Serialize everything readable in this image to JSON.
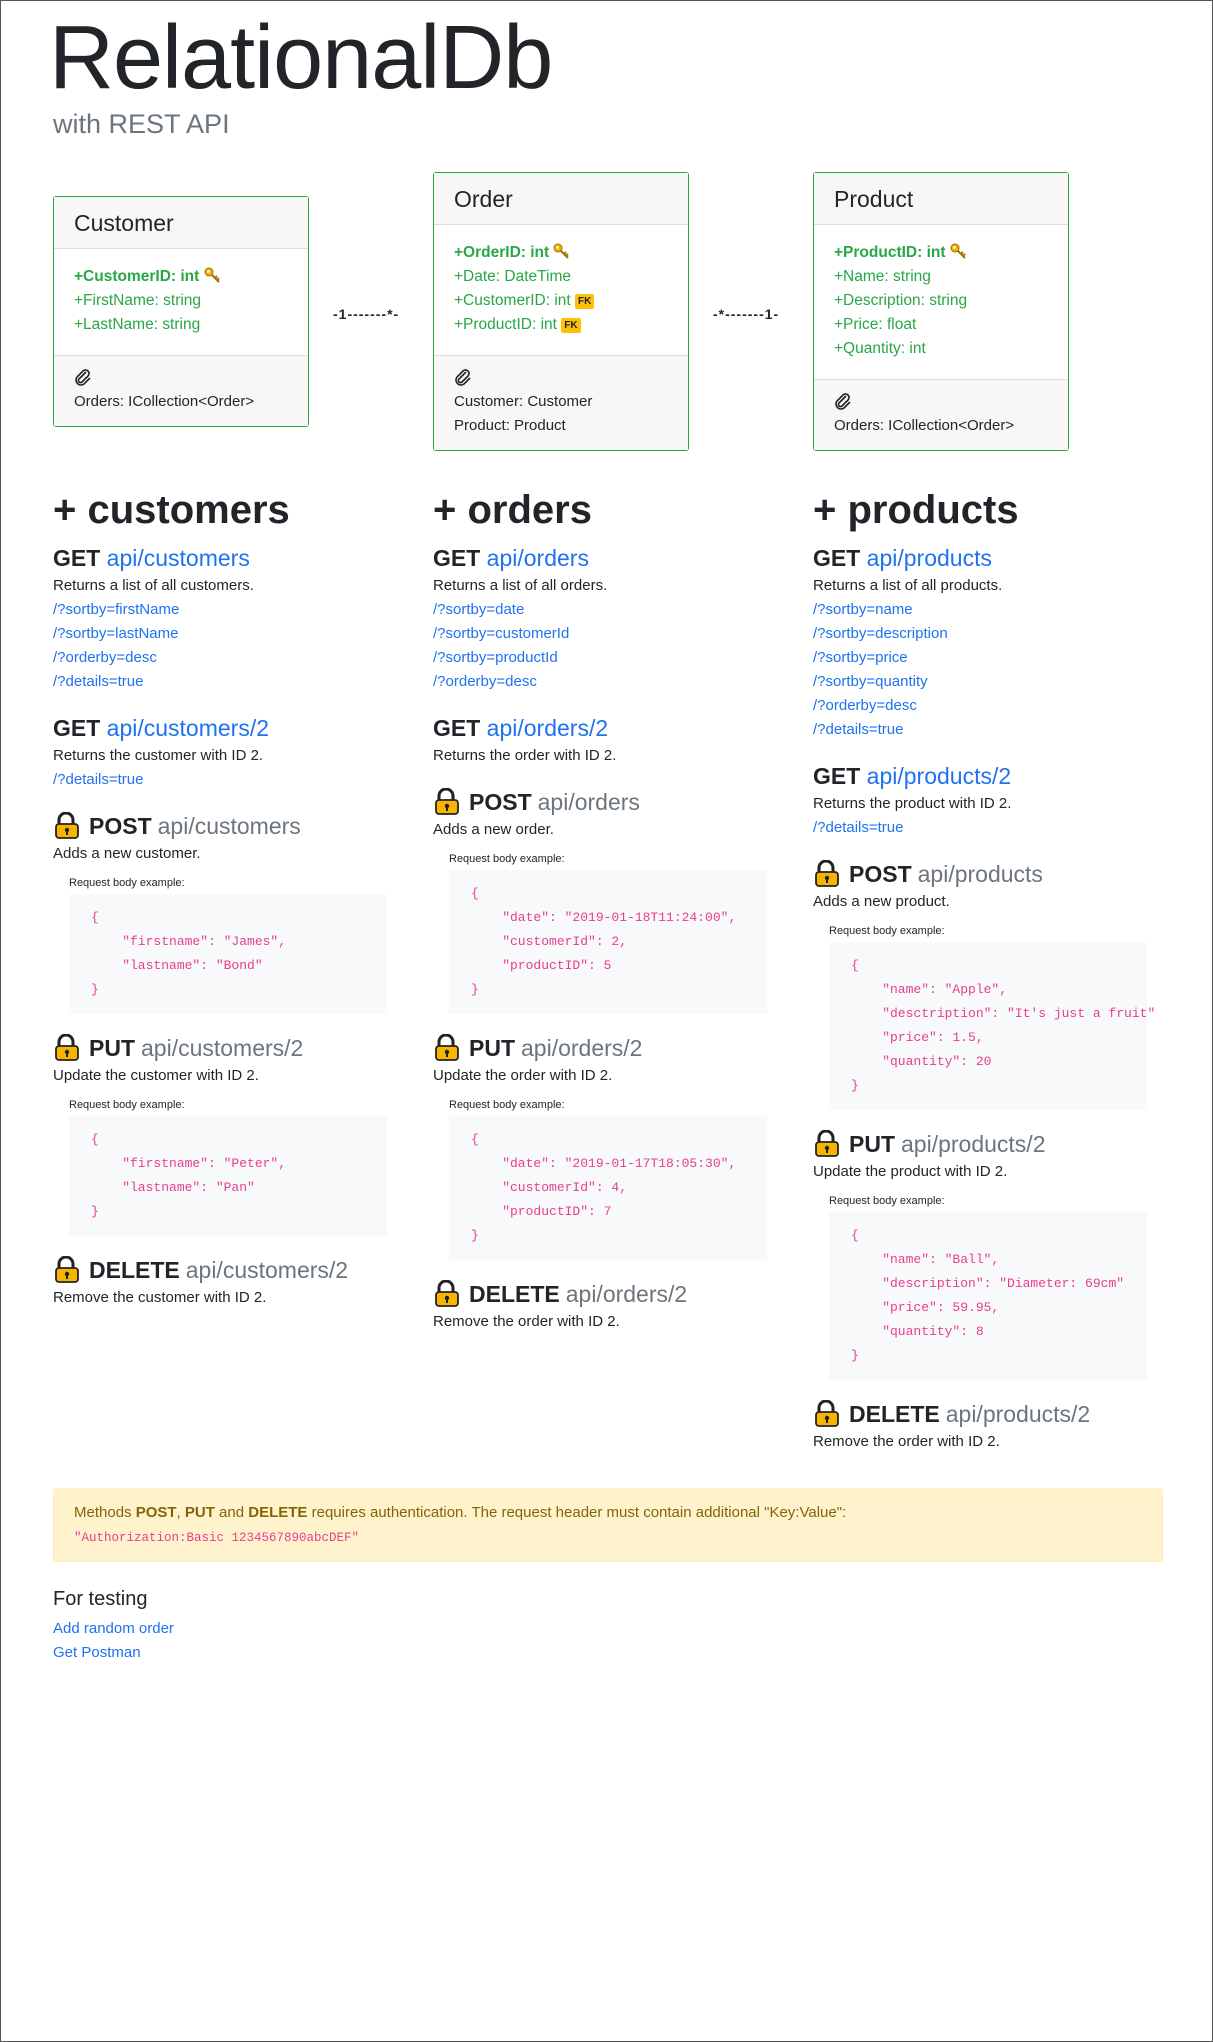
{
  "header": {
    "title": "RelationalDb",
    "subtitle": "with REST API"
  },
  "entities": [
    {
      "name": "Customer",
      "props": [
        {
          "text": "+CustomerID: int",
          "pk": true,
          "fk": false
        },
        {
          "text": "+FirstName: string",
          "pk": false,
          "fk": false
        },
        {
          "text": "+LastName: string",
          "pk": false,
          "fk": false
        }
      ],
      "nav": [
        "Orders: ICollection<Order>"
      ]
    },
    {
      "name": "Order",
      "props": [
        {
          "text": "+OrderID: int",
          "pk": true,
          "fk": false
        },
        {
          "text": "+Date: DateTime",
          "pk": false,
          "fk": false
        },
        {
          "text": "+CustomerID: int",
          "pk": false,
          "fk": true
        },
        {
          "text": "+ProductID: int",
          "pk": false,
          "fk": true
        }
      ],
      "nav": [
        "Customer: Customer",
        "Product: Product"
      ]
    },
    {
      "name": "Product",
      "props": [
        {
          "text": "+ProductID: int",
          "pk": true,
          "fk": false
        },
        {
          "text": "+Name: string",
          "pk": false,
          "fk": false
        },
        {
          "text": "+Description: string",
          "pk": false,
          "fk": false
        },
        {
          "text": "+Price: float",
          "pk": false,
          "fk": false
        },
        {
          "text": "+Quantity: int",
          "pk": false,
          "fk": false
        }
      ],
      "nav": [
        "Orders: ICollection<Order>"
      ]
    }
  ],
  "fk_label": "FK",
  "relations": [
    "-1-------*-",
    "-*-------1-"
  ],
  "columns": [
    {
      "section": "+ customers",
      "get_all": {
        "verb": "GET",
        "url": "api/customers",
        "desc": "Returns a list of all customers.",
        "links": [
          "/?sortby=firstName",
          "/?sortby=lastName",
          "/?orderby=desc",
          "/?details=true"
        ]
      },
      "get_one": {
        "verb": "GET",
        "url": "api/customers/2",
        "desc": "Returns the customer with ID 2.",
        "links": [
          "/?details=true"
        ]
      },
      "post": {
        "verb": "POST",
        "path": "api/customers",
        "desc": "Adds a new customer.",
        "body_label": "Request body example:",
        "body": "{\n    \"firstname\": \"James\",\n    \"lastname\": \"Bond\"\n}"
      },
      "put": {
        "verb": "PUT",
        "path": "api/customers/2",
        "desc": "Update the customer with ID 2.",
        "body_label": "Request body example:",
        "body": "{\n    \"firstname\": \"Peter\",\n    \"lastname\": \"Pan\"\n}"
      },
      "delete": {
        "verb": "DELETE",
        "path": "api/customers/2",
        "desc": "Remove the customer with ID 2."
      }
    },
    {
      "section": "+ orders",
      "get_all": {
        "verb": "GET",
        "url": "api/orders",
        "desc": "Returns a list of all orders.",
        "links": [
          "/?sortby=date",
          "/?sortby=customerId",
          "/?sortby=productId",
          "/?orderby=desc"
        ]
      },
      "get_one": {
        "verb": "GET",
        "url": "api/orders/2",
        "desc": "Returns the order with ID 2.",
        "links": []
      },
      "post": {
        "verb": "POST",
        "path": "api/orders",
        "desc": "Adds a new order.",
        "body_label": "Request body example:",
        "body": "{\n    \"date\": \"2019-01-18T11:24:00\",\n    \"customerId\": 2,\n    \"productID\": 5\n}"
      },
      "put": {
        "verb": "PUT",
        "path": "api/orders/2",
        "desc": "Update the order with ID 2.",
        "body_label": "Request body example:",
        "body": "{\n    \"date\": \"2019-01-17T18:05:30\",\n    \"customerId\": 4,\n    \"productID\": 7\n}"
      },
      "delete": {
        "verb": "DELETE",
        "path": "api/orders/2",
        "desc": "Remove the order with ID 2."
      }
    },
    {
      "section": "+ products",
      "get_all": {
        "verb": "GET",
        "url": "api/products",
        "desc": "Returns a list of all products.",
        "links": [
          "/?sortby=name",
          "/?sortby=description",
          "/?sortby=price",
          "/?sortby=quantity",
          "/?orderby=desc",
          "/?details=true"
        ]
      },
      "get_one": {
        "verb": "GET",
        "url": "api/products/2",
        "desc": "Returns the product with ID 2.",
        "links": [
          "/?details=true"
        ]
      },
      "post": {
        "verb": "POST",
        "path": "api/products",
        "desc": "Adds a new product.",
        "body_label": "Request body example:",
        "body": "{\n    \"name\": \"Apple\",\n    \"desctription\": \"It's just a fruit\"\n    \"price\": 1.5,\n    \"quantity\": 20\n}"
      },
      "put": {
        "verb": "PUT",
        "path": "api/products/2",
        "desc": "Update the product with ID 2.",
        "body_label": "Request body example:",
        "body": "{\n    \"name\": \"Ball\",\n    \"description\": \"Diameter: 69cm\"\n    \"price\": 59.95,\n    \"quantity\": 8\n}"
      },
      "delete": {
        "verb": "DELETE",
        "path": "api/products/2",
        "desc": "Remove the order with ID 2."
      }
    }
  ],
  "alert": {
    "pre": "Methods ",
    "m1": "POST",
    "sep1": ", ",
    "m2": "PUT",
    "sep2": " and ",
    "m3": "DELETE",
    "post": " requires authentication. The request header must contain additional \"Key:Value\":",
    "header": "\"Authorization:Basic 1234567890abcDEF\""
  },
  "testing": {
    "title": "For testing",
    "links": [
      "Add random order",
      "Get Postman"
    ]
  },
  "colors": {
    "entity_border": "#28a745",
    "link": "#1f72f0",
    "alert_bg": "#fff3cd",
    "code": "#e83e8c"
  }
}
